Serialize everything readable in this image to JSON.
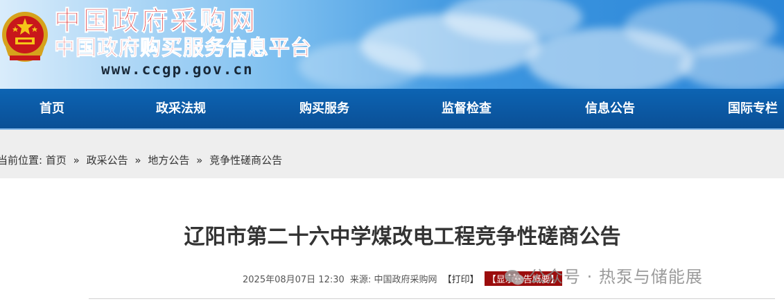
{
  "header": {
    "site_title": "中国政府采购网",
    "site_subtitle": "中国政府购买服务信息平台",
    "site_url": "www.ccgp.gov.cn",
    "emblem_icon": "national-emblem-icon"
  },
  "nav": {
    "items": [
      {
        "label": "首页"
      },
      {
        "label": "政采法规"
      },
      {
        "label": "购买服务"
      },
      {
        "label": "监督检查"
      },
      {
        "label": "信息公告"
      },
      {
        "label": "国际专栏"
      }
    ]
  },
  "breadcrumb": {
    "prefix": "当前位置:",
    "items": [
      "首页",
      "政采公告",
      "地方公告",
      "竞争性磋商公告"
    ],
    "separator": "»"
  },
  "article": {
    "title": "辽阳市第二十六中学煤改电工程竞争性磋商公告",
    "datetime": "2025年08月07日 12:30",
    "source_label": "来源:",
    "source": "中国政府采购网",
    "print_label": "【打印】",
    "summary_label": "【显示公告概要】"
  },
  "watermark": {
    "text": "公众号 · 热泵与储能展",
    "icon": "wechat-icon"
  },
  "colors": {
    "nav_bg": "#0a5aa8",
    "logo_red": "#d8191d",
    "summary_bg": "#9b0d0d"
  }
}
